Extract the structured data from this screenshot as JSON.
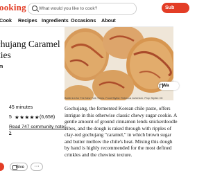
{
  "header": {
    "logo": "ooking",
    "search_placeholder": "What would you like to cook?",
    "subscribe_label": "Sub"
  },
  "nav": {
    "items": [
      "Cook",
      "Recipes",
      "Ingredients",
      "Occasions",
      "About"
    ]
  },
  "recipe": {
    "title_line1": "ochujang Caramel",
    "title_line2": "kies",
    "byline": "m",
    "time_label": "",
    "time_value": "45 minutes",
    "rating_value": "5",
    "stars": "★★★★★",
    "rating_count": "(6,658)",
    "notes_line1": "Read 747 community notes",
    "notes_line2": "s",
    "photo_caption": "Bobbi Lin for The New York Times. Food Stylist: Rebecca Jurkevich. Prop Stylist: Oli",
    "save_label": "Wa",
    "description": "Gochujang, the fermented Korean chile paste, offers intrigue in this otherwise classic chewy sugar cookie. A gentle amount of ground cinnamon lends snickerdoodle vibes, and the dough is raked through with ripples of clay-red gochujang \"caramel,\" in which brown sugar and butter mellow the chile's heat. Mixing this dough by hand is highly recommended for the most defined crinkles and the chewiest texture."
  },
  "actions": {
    "give_label": "Give",
    "more_label": "···"
  },
  "colors": {
    "brand_red": "#e33d26"
  }
}
